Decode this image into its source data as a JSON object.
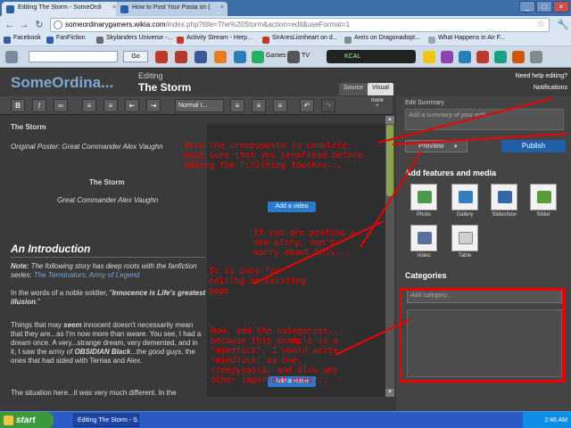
{
  "browser": {
    "tabs": [
      {
        "label": "Editing The Storm - SomeOrdi"
      },
      {
        "label": "How to Post Your Pasta on ("
      }
    ],
    "url_domain": "someordinarygamers.wikia.com",
    "url_rest": "/index.php?title=The%20Storm&action=edit&useFormat=1",
    "bookmarks": [
      "Facebook",
      "FanFiction",
      "Skylanders Universe -...",
      "Activity Stream - Herp...",
      "SirAresLionheart on d...",
      "Areis on Dragonadopt...",
      "What Happens in Air F..."
    ],
    "ext_go": "Go",
    "ext_games": "Games",
    "ext_tv": "TV",
    "ext_radio": "KCAL"
  },
  "wiki": {
    "name": "SomeOrdina...",
    "editing_label": "Editing",
    "page_title": "The Storm",
    "tab_source": "Source",
    "tab_visual": "Visual",
    "need_help": "Need help editing?",
    "notifications": "Notifications",
    "format_select": "Normal t...",
    "more_label": "more"
  },
  "editor": {
    "title_line": "The Storm",
    "poster_line": "Original Poster: Great Commander Alex Vaughn",
    "center_title": "The Storm",
    "center_author": "Great Commander Alex Vaughn",
    "add_video": "Add a video",
    "add_video_2": "Add a video",
    "intro_heading": "An Introduction",
    "note_prefix": "Note:",
    "note_text1": " The following story has deep roots with the fanfiction",
    "note_text2": "series: ",
    "note_link": "The Terminators: Army of Legend",
    "para1_a": "In the words of a noble soldier, \"",
    "para1_b": "Innocence is Life's greatest",
    "para1_c": "illusion",
    "para1_d": ".\"",
    "para2_l1a": "Things that may ",
    "para2_l1b": "seem",
    "para2_l1c": " innocent doesn't necessarily mean",
    "para2_l2": "that they are...as I'm now more than aware. You see, I had a",
    "para2_l3": "dream once. A very...strange dream, very demented, and in",
    "para2_l4a": "it, I saw the army of ",
    "para2_l4b": "OBSIDIAN Black",
    "para2_l4c": "...the ",
    "para2_l4d": "good",
    "para2_l4e": " guys, the",
    "para2_l5": "ones that had sided with Terrias and Alex.",
    "para3": "The situation here...it was very much different. In the"
  },
  "sidebar": {
    "edit_summary_label": "Edit Summary",
    "summary_placeholder": "Add a summary of your edit",
    "preview": "Preview",
    "publish": "Publish",
    "features_heading": "Add features and media",
    "features": [
      "Photo",
      "Gallery",
      "Slideshow",
      "Slider",
      "Video",
      "Table"
    ],
    "categories_heading": "Categories",
    "category_placeholder": "Add category..."
  },
  "annotations": {
    "note1": "Once the creepypasta is complete,\nmake sure that you proofread before\nadding the finishing touches...",
    "note2": "If you are posting a\nnew story, don't\nworry about this...",
    "note3": "It is only for\nediting an existing\npage",
    "note4": "Now, add the categories...\nbecause this example is a\n\"mindfuck\", I would write\n\"mindfuck\" as one,\ncreepypasta, and also any\nother important ones..."
  },
  "taskbar": {
    "start": "start",
    "task": "Editing The Storm - S...",
    "clock": "2:46 AM"
  },
  "colors": {
    "annotation_red": "#e00000",
    "publish_blue": "#1f5ea8",
    "wiki_name": "#7aa8d6"
  }
}
